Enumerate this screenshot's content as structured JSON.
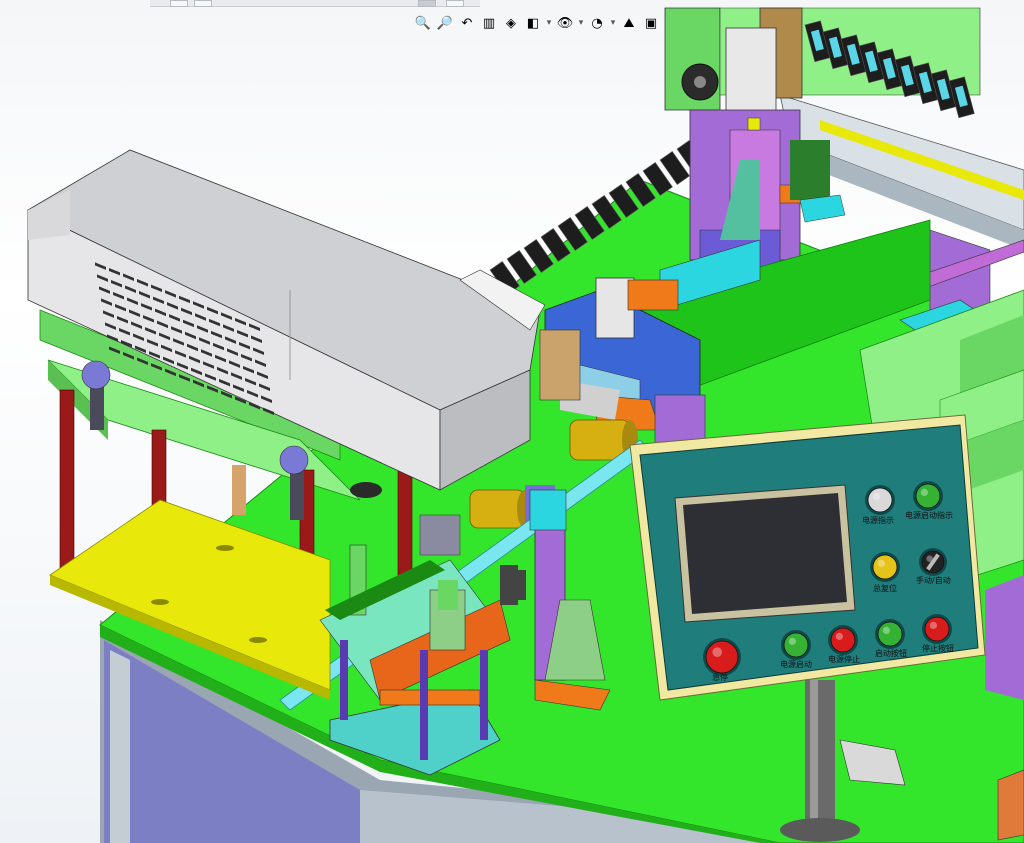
{
  "window": {
    "title": ""
  },
  "heads_up_toolbar": {
    "buttons": [
      {
        "name": "zoom-to-fit-icon",
        "glyph": "🔍"
      },
      {
        "name": "zoom-to-area-icon",
        "glyph": "🔎"
      },
      {
        "name": "previous-view-icon",
        "glyph": "↶"
      },
      {
        "name": "section-view-icon",
        "glyph": "▥"
      },
      {
        "name": "view-orientation-icon",
        "glyph": "◈"
      },
      {
        "name": "display-style-icon",
        "glyph": "◧"
      },
      {
        "name": "hide-show-items-icon",
        "glyph": "👁"
      },
      {
        "name": "edit-appearance-icon",
        "glyph": "◔"
      },
      {
        "name": "apply-scene-icon",
        "glyph": "⛰"
      },
      {
        "name": "view-settings-icon",
        "glyph": "▣"
      }
    ]
  },
  "control_panel": {
    "labels": {
      "power_indicator": "电源指示",
      "power_start_indicator": "电源启动指示",
      "reset": "总复位",
      "manual_auto": "手动/自动",
      "estop": "急停",
      "power_start": "电源启动",
      "power_off": "电源停止",
      "start_button": "启动按钮",
      "stop_button": "停止按钮"
    },
    "colors": {
      "panel_face": "#1f7d7c",
      "bezel": "#f1e9a1",
      "screen": "#2e2e35",
      "green_button": "#35b233",
      "red_button": "#d81b1b",
      "yellow_button": "#e6c31a",
      "white_lamp": "#d9d9d9"
    }
  },
  "scene_colors": {
    "table_green": "#33e62b",
    "laser_housing": "#d6d6d8",
    "yellow_plate": "#e8e80a",
    "purple_part": "#a36bd6",
    "cyan_part": "#2bd6e0",
    "orange_part": "#f07a1a",
    "red_column": "#9a1a1a",
    "chain_black": "#1d1d1d"
  }
}
